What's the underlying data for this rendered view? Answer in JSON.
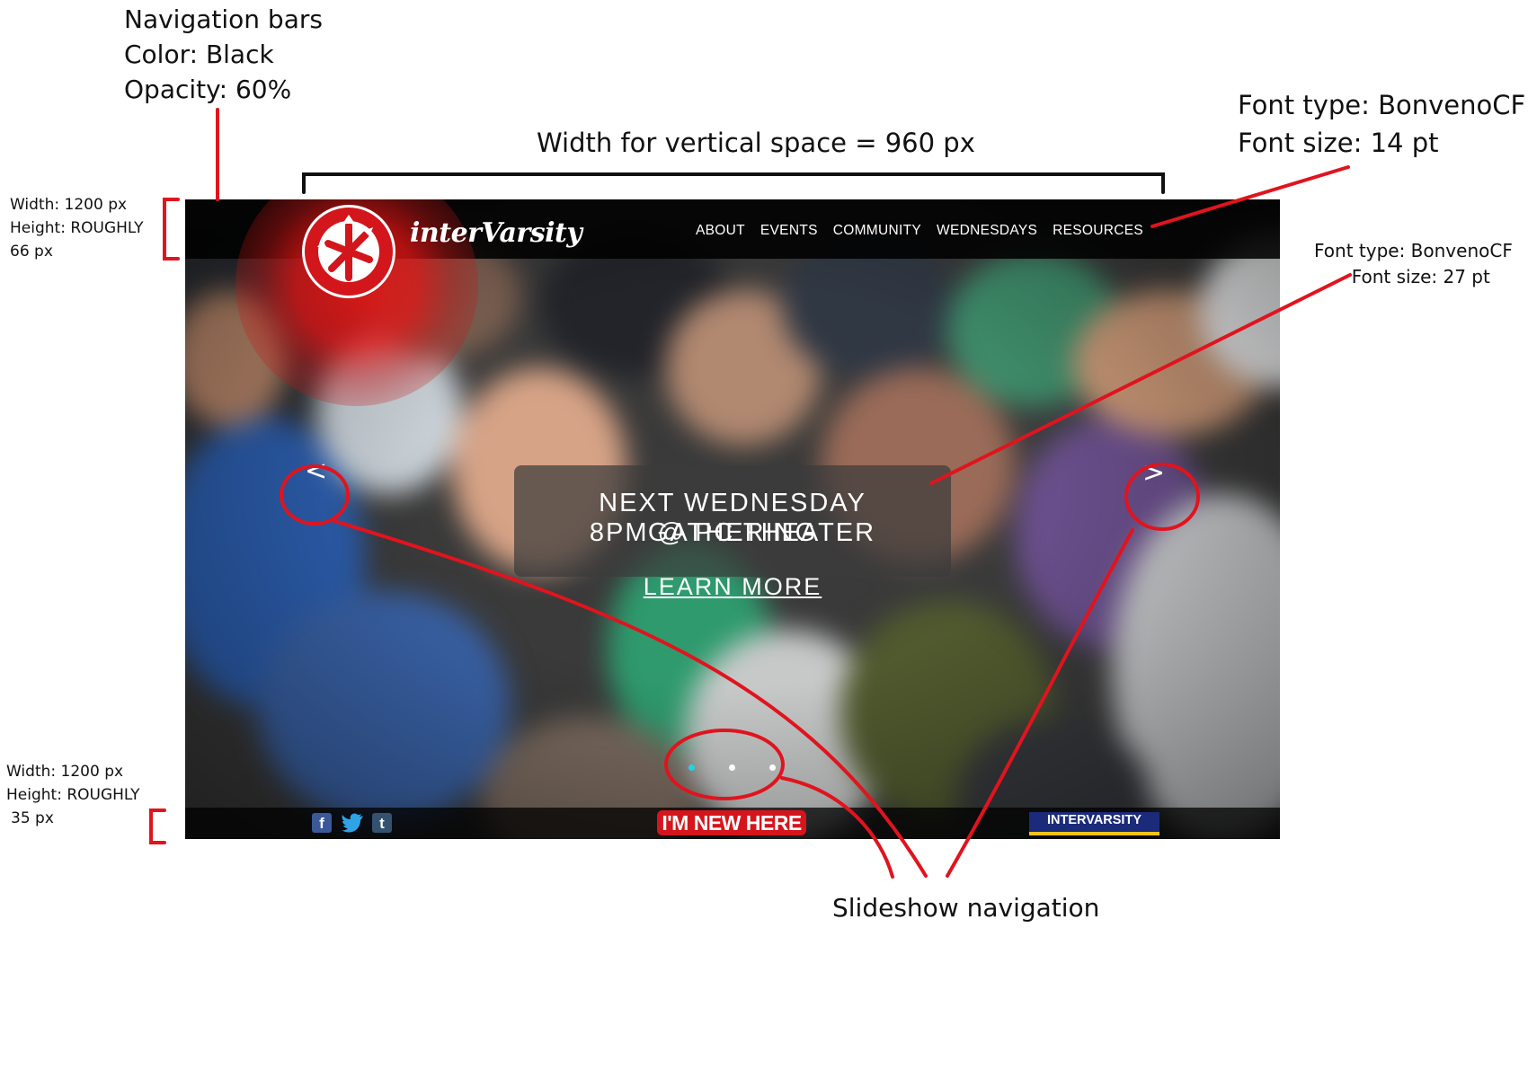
{
  "annotations": {
    "nav_bars": [
      "Navigation bars",
      "Color: Black",
      "Opacity: 60%"
    ],
    "width_vertical": "Width for vertical space = 960 px",
    "nav_font": [
      "Font type: BonvenoCF",
      "Font size: 14 pt"
    ],
    "caption_font": [
      "Font type: BonvenoCF",
      "Font size: 27 pt"
    ],
    "top_bar_dims": [
      "Width: 1200 px",
      "Height: ROUGHLY",
      "66 px"
    ],
    "bottom_bar_dims": [
      "Width: 1200 px",
      "Height: ROUGHLY",
      "35 px"
    ],
    "slideshow": "Slideshow navigation"
  },
  "nav": {
    "logo_text": "interVarsity",
    "items": [
      "ABOUT",
      "EVENTS",
      "COMMUNITY",
      "WEDNESDAYS",
      "RESOURCES"
    ]
  },
  "hero": {
    "line1": "NEXT WEDNESDAY GATHERING",
    "line2": "8PM @ PC THEATER",
    "cta": "LEARN MORE",
    "prev": "<",
    "next": ">",
    "dots": 3,
    "active_dot": 0
  },
  "footer": {
    "social": [
      "f",
      "t"
    ],
    "new_here": "I'M NEW HERE",
    "badge": "INTERVARSITY"
  },
  "colors": {
    "annotation": "#e0141e",
    "logo_red": "#d2161c",
    "active_dot": "#22d3e6",
    "badge_blue": "#1b2b7a",
    "badge_gold": "#f1c417"
  }
}
